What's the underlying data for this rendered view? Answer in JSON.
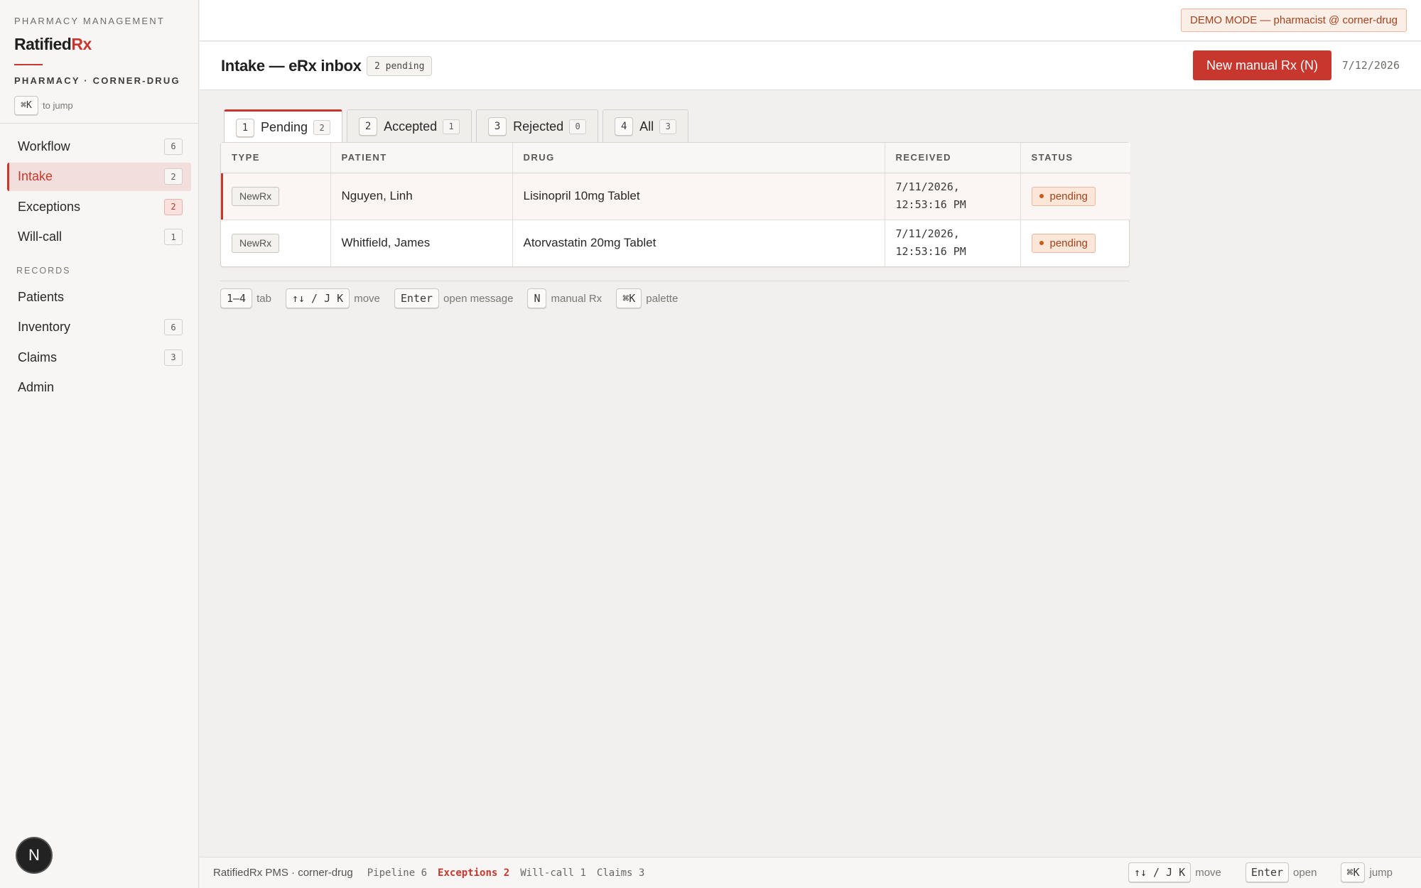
{
  "sidebar": {
    "eyebrow": "PHARMACY MANAGEMENT",
    "brand_main": "Ratified",
    "brand_accent": "Rx",
    "pharmacy": "PHARMACY · CORNER-DRUG",
    "jump_key": "⌘K",
    "jump_label": "to jump",
    "items": [
      {
        "label": "Workflow",
        "count": "6"
      },
      {
        "label": "Intake",
        "count": "2"
      },
      {
        "label": "Exceptions",
        "count": "2"
      },
      {
        "label": "Will-call",
        "count": "1"
      }
    ],
    "records_heading": "RECORDS",
    "records": [
      {
        "label": "Patients"
      },
      {
        "label": "Inventory",
        "count": "6"
      },
      {
        "label": "Claims",
        "count": "3"
      },
      {
        "label": "Admin"
      }
    ],
    "avatar_letter": "N"
  },
  "topbar": {
    "demo_badge": "DEMO MODE — pharmacist @ corner-drug"
  },
  "header": {
    "title": "Intake — eRx inbox",
    "pending_chip": "2 pending",
    "new_button": "New manual Rx (N)",
    "date": "7/12/2026"
  },
  "tabs": [
    {
      "key": "1",
      "label": "Pending",
      "count": "2"
    },
    {
      "key": "2",
      "label": "Accepted",
      "count": "1"
    },
    {
      "key": "3",
      "label": "Rejected",
      "count": "0"
    },
    {
      "key": "4",
      "label": "All",
      "count": "3"
    }
  ],
  "table": {
    "columns": [
      "TYPE",
      "PATIENT",
      "DRUG",
      "RECEIVED",
      "STATUS"
    ],
    "rows": [
      {
        "type": "NewRx",
        "patient": "Nguyen, Linh",
        "drug": "Lisinopril 10mg Tablet",
        "received_date": "7/11/2026,",
        "received_time": "12:53:16 PM",
        "status": "pending"
      },
      {
        "type": "NewRx",
        "patient": "Whitfield, James",
        "drug": "Atorvastatin 20mg Tablet",
        "received_date": "7/11/2026,",
        "received_time": "12:53:16 PM",
        "status": "pending"
      }
    ]
  },
  "hints": [
    {
      "key": "1–4",
      "label": "tab"
    },
    {
      "key": "↑↓ / J K",
      "label": "move"
    },
    {
      "key": "Enter",
      "label": "open message"
    },
    {
      "key": "N",
      "label": "manual Rx"
    },
    {
      "key": "⌘K",
      "label": "palette"
    }
  ],
  "footer": {
    "app": "RatifiedRx PMS · corner-drug",
    "stats": {
      "pipeline": "Pipeline 6",
      "exceptions": "Exceptions 2",
      "willcall": "Will-call 1",
      "claims": "Claims 3"
    },
    "hints": [
      {
        "key": "↑↓ / J K",
        "label": "move"
      },
      {
        "key": "Enter",
        "label": "open"
      },
      {
        "key": "⌘K",
        "label": "jump"
      }
    ]
  },
  "colors": {
    "accent": "#c8372d",
    "warning": "#a2411b"
  }
}
